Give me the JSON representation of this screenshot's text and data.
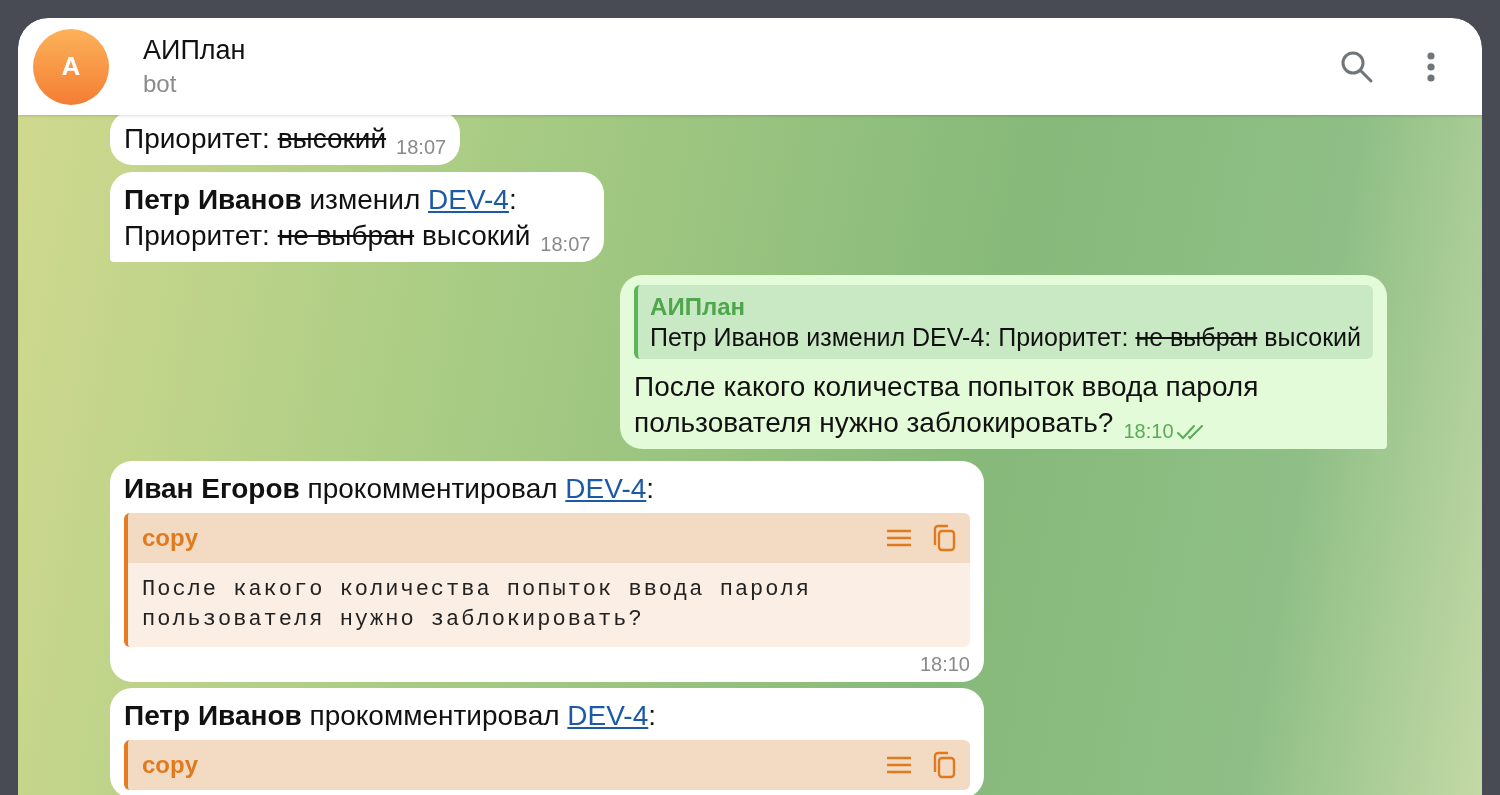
{
  "header": {
    "avatar_letter": "А",
    "title": "АИПлан",
    "subtitle": "bot"
  },
  "messages": [
    {
      "kind": "incoming",
      "tail": false,
      "lines": [
        [
          {
            "kind": "text",
            "text": "Приоритет: "
          },
          {
            "kind": "strike",
            "text": "высокий"
          }
        ]
      ],
      "time": "18:07"
    },
    {
      "kind": "incoming",
      "tail": true,
      "lines": [
        [
          {
            "kind": "bold",
            "text": "Петр Иванов"
          },
          {
            "kind": "text",
            "text": " изменил "
          },
          {
            "kind": "link",
            "text": "DEV-4"
          },
          {
            "kind": "text",
            "text": ":"
          }
        ],
        [
          {
            "kind": "text",
            "text": "Приоритет: "
          },
          {
            "kind": "strike",
            "text": "не выбран"
          },
          {
            "kind": "text",
            "text": " высокий"
          }
        ]
      ],
      "time": "18:07"
    },
    {
      "kind": "outgoing",
      "tail": true,
      "reply": {
        "author": "АИПлан",
        "segments": [
          {
            "kind": "text",
            "text": "Петр Иванов изменил DEV-4: Приоритет: "
          },
          {
            "kind": "strike",
            "text": "не выбран"
          },
          {
            "kind": "text",
            "text": " высокий"
          }
        ]
      },
      "lines": [
        [
          {
            "kind": "text",
            "text": "После какого количества попыток ввода пароля"
          }
        ],
        [
          {
            "kind": "text",
            "text": "пользователя нужно заблокировать?"
          }
        ]
      ],
      "time": "18:10",
      "read": true
    },
    {
      "kind": "incoming",
      "tail": false,
      "lines": [
        [
          {
            "kind": "bold",
            "text": "Иван Егоров"
          },
          {
            "kind": "text",
            "text": " прокомментировал "
          },
          {
            "kind": "link",
            "text": "DEV-4"
          },
          {
            "kind": "text",
            "text": ":"
          }
        ]
      ],
      "code": {
        "label": "copy",
        "text": "После какого количества попыток ввода пароля\nпользователя нужно заблокировать?"
      },
      "time": "18:10"
    },
    {
      "kind": "incoming",
      "tail": false,
      "lines": [
        [
          {
            "kind": "bold",
            "text": "Петр Иванов"
          },
          {
            "kind": "text",
            "text": " прокомментировал "
          },
          {
            "kind": "link",
            "text": "DEV-4"
          },
          {
            "kind": "text",
            "text": ":"
          }
        ]
      ],
      "code": {
        "label": "copy"
      }
    }
  ]
}
